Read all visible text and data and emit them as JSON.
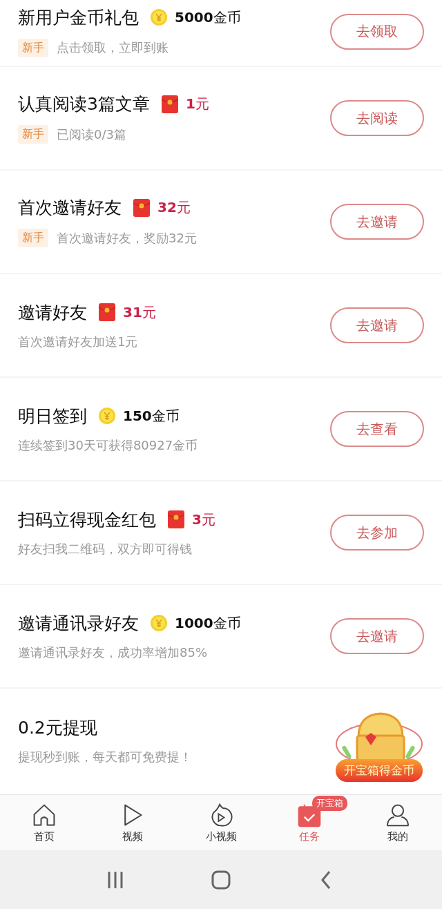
{
  "tasks": [
    {
      "title": "新用户金币礼包",
      "reward": {
        "kind": "coin",
        "amount": "**5000**金币"
      },
      "tag": "新手",
      "subtitle": "点击领取，立即到账",
      "action": {
        "kind": "button",
        "label": "去领取"
      }
    },
    {
      "title": "认真阅读3篇文章",
      "reward": {
        "kind": "redpacket",
        "amount": "**1**元"
      },
      "tag": "新手",
      "subtitle": "已阅读0/3篇",
      "action": {
        "kind": "button",
        "label": "去阅读"
      }
    },
    {
      "title": "首次邀请好友",
      "reward": {
        "kind": "redpacket",
        "amount": "**32**元"
      },
      "tag": "新手",
      "subtitle": "首次邀请好友，奖励32元",
      "action": {
        "kind": "button",
        "label": "去邀请"
      }
    },
    {
      "title": "邀请好友",
      "reward": {
        "kind": "redpacket",
        "amount": "**31**元"
      },
      "subtitle": "首次邀请好友加送1元",
      "action": {
        "kind": "button",
        "label": "去邀请"
      }
    },
    {
      "title": "明日签到",
      "reward": {
        "kind": "coin",
        "amount": "**150**金币"
      },
      "subtitle": "连续签到30天可获得80927金币",
      "action": {
        "kind": "button",
        "label": "去查看"
      }
    },
    {
      "title": "扫码立得现金红包",
      "reward": {
        "kind": "redpacket",
        "amount": "**3**元"
      },
      "subtitle": "好友扫我二维码，双方即可得钱",
      "action": {
        "kind": "button",
        "label": "去参加"
      }
    },
    {
      "title": "邀请通讯录好友",
      "reward": {
        "kind": "coin",
        "amount": "**1000**金币"
      },
      "subtitle": "邀请通讯录好友，成功率增加85%",
      "action": {
        "kind": "button",
        "label": "去邀请"
      }
    },
    {
      "title": "0.2元提现",
      "subtitle": "提现秒到账，每天都可免费提！",
      "action": {
        "kind": "chest",
        "label": "开宝箱得金币"
      }
    }
  ],
  "tab_bar": [
    {
      "kind": "home",
      "label": "首页",
      "selected": false
    },
    {
      "kind": "video",
      "label": "视频",
      "selected": false
    },
    {
      "kind": "shorts",
      "label": "小视频",
      "selected": false
    },
    {
      "kind": "tasks",
      "label": "任务",
      "selected": true,
      "badge": "开宝箱"
    },
    {
      "kind": "profile",
      "label": "我的",
      "selected": false
    }
  ]
}
